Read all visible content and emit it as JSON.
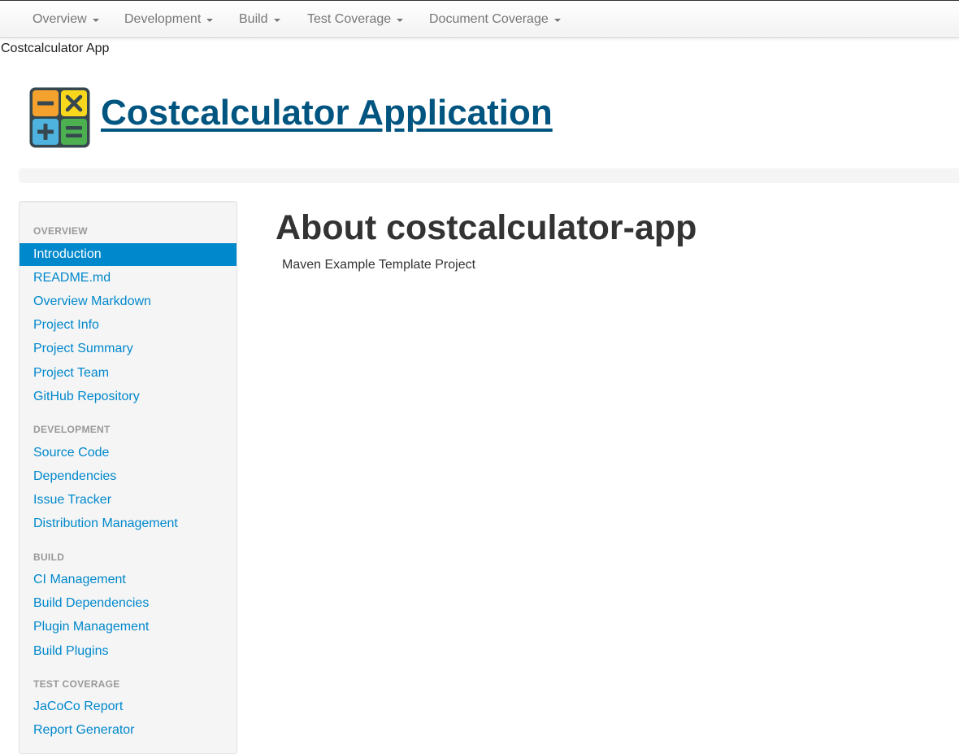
{
  "navbar": {
    "menus": [
      "Overview",
      "Development",
      "Build",
      "Test Coverage",
      "Document Coverage"
    ]
  },
  "page": {
    "small_title": "Costcalculator App",
    "app_title": "Costcalculator Application",
    "heading": "About costcalculator-app",
    "description": "Maven Example Template Project"
  },
  "sidebar": {
    "overview": {
      "header": "Overview",
      "items": [
        "Introduction",
        "README.md",
        "Overview Markdown",
        "Project Info",
        "Project Summary",
        "Project Team",
        "GitHub Repository"
      ]
    },
    "development": {
      "header": "Development",
      "items": [
        "Source Code",
        "Dependencies",
        "Issue Tracker",
        "Distribution Management"
      ]
    },
    "build": {
      "header": "Build",
      "items": [
        "CI Management",
        "Build Dependencies",
        "Plugin Management",
        "Build Plugins"
      ]
    },
    "test_coverage": {
      "header": "Test Coverage",
      "items": [
        "JaCoCo Report",
        "Report Generator"
      ]
    },
    "active_item": "Introduction"
  },
  "colors": {
    "link": "#0088cc",
    "title_link": "#005580",
    "active_bg": "#0088cc"
  },
  "icons": {
    "logo": "calculator-icon",
    "dropdown": "caret-down-icon"
  }
}
